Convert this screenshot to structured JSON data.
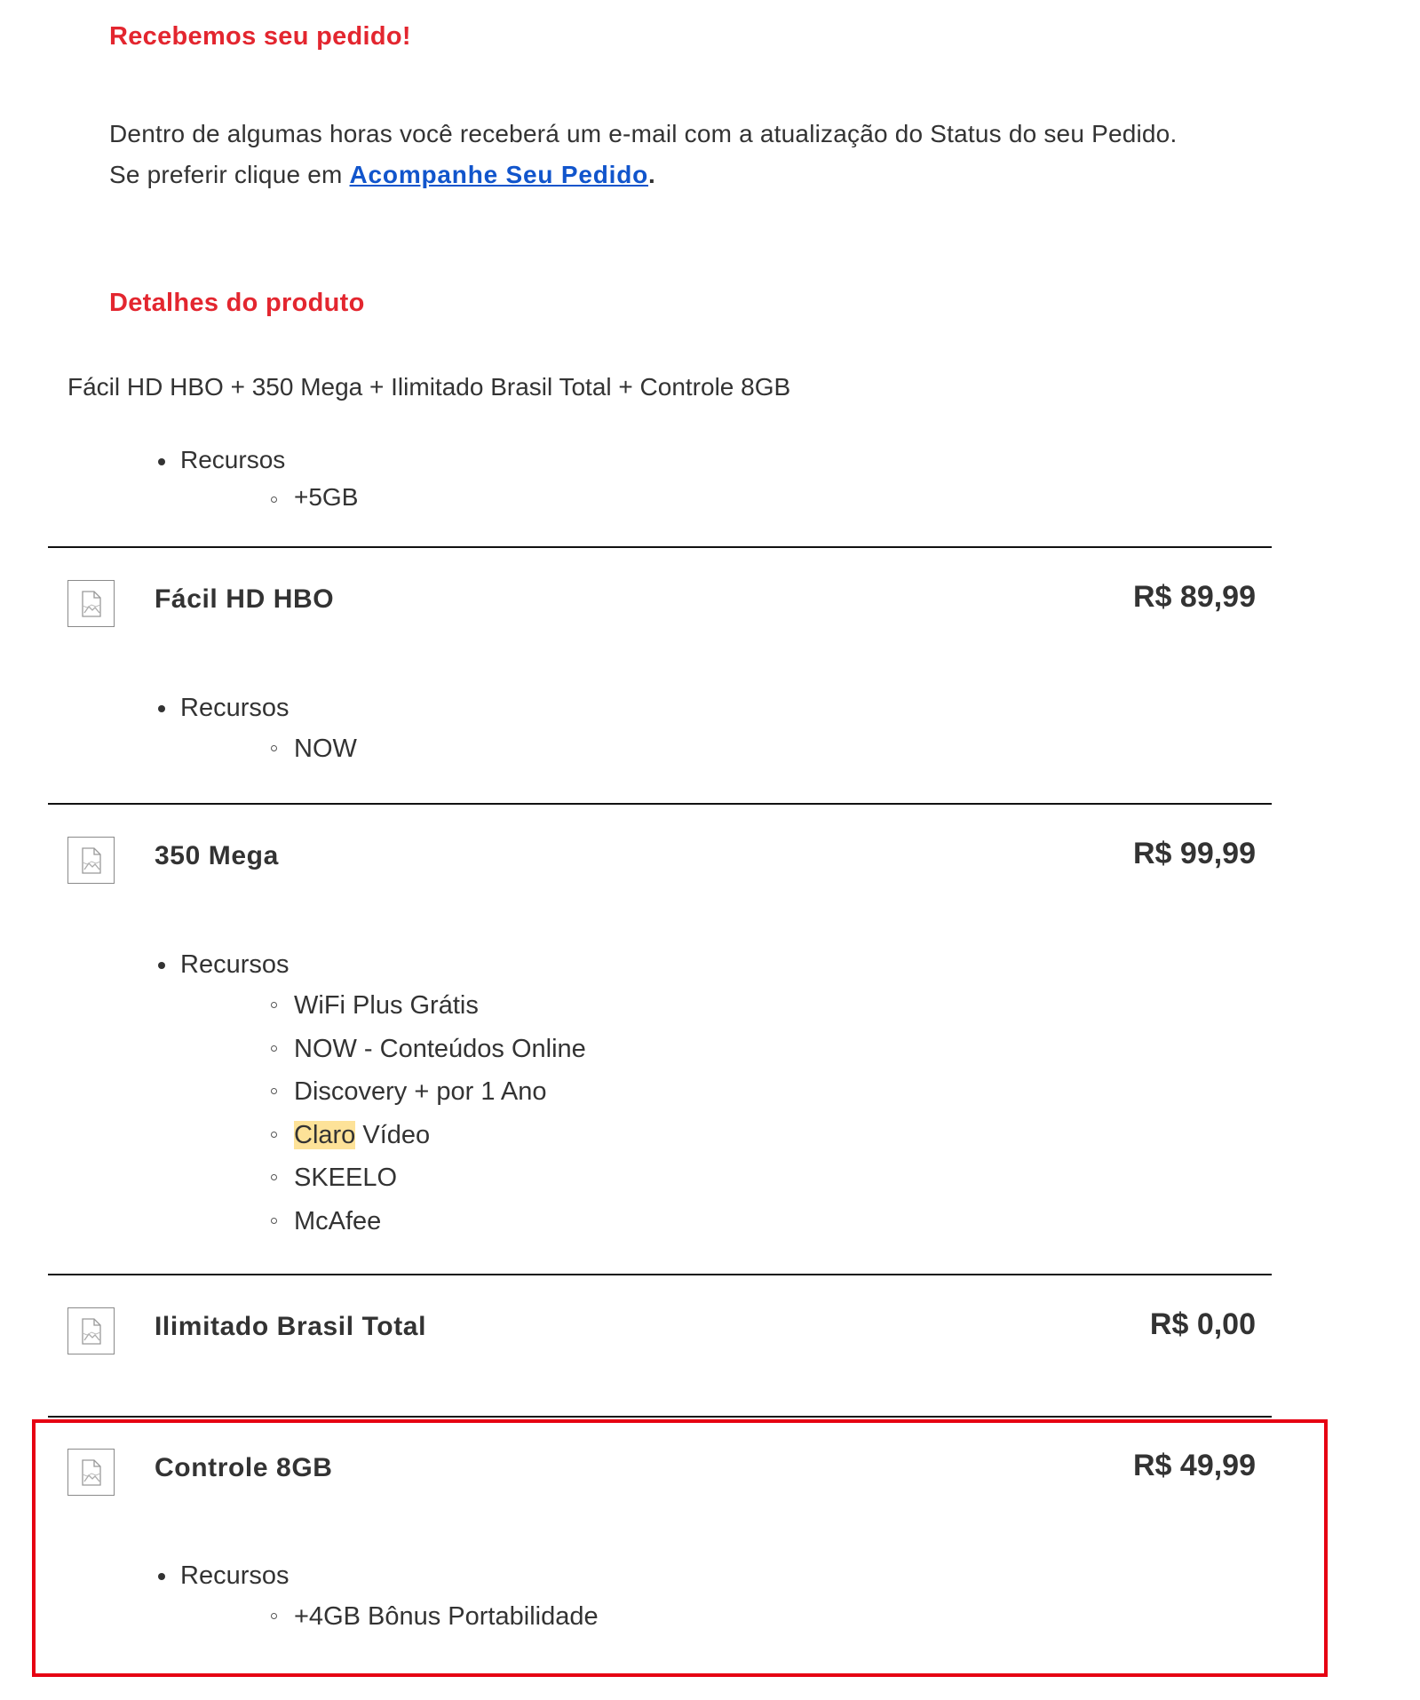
{
  "heading_received": "Recebemos seu pedido!",
  "intro": {
    "line1": "Dentro de algumas horas você receberá um e-mail com a atualização do Status do seu Pedido.",
    "line2_prefix": "Se preferir clique em",
    "link": "Acompanhe Seu Pedido",
    "line2_suffix": "."
  },
  "heading_details": "Detalhes do produto",
  "bundle": {
    "name": "Fácil HD HBO + 350 Mega + Ilimitado Brasil Total + Controle 8GB",
    "resources_label": "Recursos",
    "resources": [
      "+5GB"
    ]
  },
  "products": [
    {
      "name": "Fácil HD HBO",
      "price": "R$ 89,99",
      "resources_label": "Recursos",
      "resources": [
        "NOW"
      ]
    },
    {
      "name": "350 Mega",
      "price": "R$ 99,99",
      "resources_label": "Recursos",
      "resources": [
        "WiFi Plus Grátis",
        "NOW - Conteúdos Online",
        "Discovery + por 1 Ano",
        "Claro",
        "Vídeo",
        "SKEELO",
        "McAfee"
      ]
    },
    {
      "name": "Ilimitado Brasil Total",
      "price": "R$ 0,00"
    },
    {
      "name": "Controle 8GB",
      "price": "R$ 49,99",
      "resources_label": "Recursos",
      "resources": [
        "+4GB Bônus Portabilidade"
      ]
    }
  ],
  "colors": {
    "heading": "#e3262f",
    "link": "#1155cc",
    "highlight": "#fde298",
    "annotation_box": "#e60012"
  },
  "icons": {
    "product_thumb": "broken-image-icon"
  }
}
